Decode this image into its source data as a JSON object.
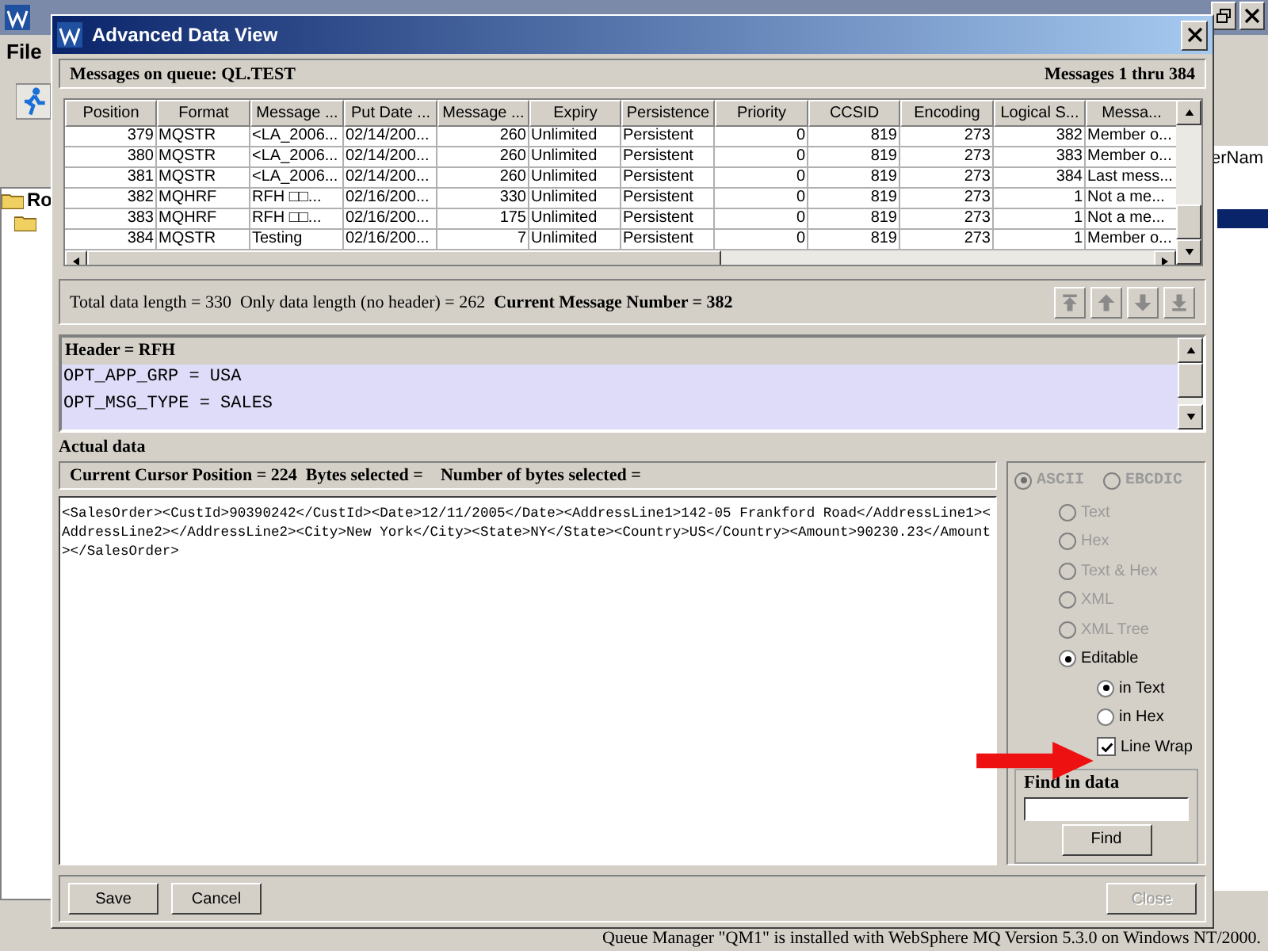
{
  "background": {
    "menu": "File",
    "tree_item": "Ro",
    "column_header": "erNam",
    "status_bar": "Queue Manager \"QM1\" is installed with WebSphere MQ Version 5.3.0 on Windows NT/2000."
  },
  "window": {
    "title": "Advanced Data View"
  },
  "queue_bar": {
    "queue": "Messages on queue: QL.TEST",
    "range": "Messages 1 thru 384"
  },
  "table": {
    "columns": [
      "Position",
      "Format",
      "Message ...",
      "Put Date ...",
      "Message ...",
      "Expiry",
      "Persistence",
      "Priority",
      "CCSID",
      "Encoding",
      "Logical S...",
      "Messa..."
    ],
    "numeric": [
      true,
      false,
      false,
      false,
      true,
      false,
      false,
      true,
      true,
      true,
      true,
      false
    ],
    "rows": [
      [
        "379",
        "MQSTR",
        "<LA_2006...",
        "02/14/200...",
        "260",
        "Unlimited",
        "Persistent",
        "0",
        "819",
        "273",
        "382",
        "Member o..."
      ],
      [
        "380",
        "MQSTR",
        "<LA_2006...",
        "02/14/200...",
        "260",
        "Unlimited",
        "Persistent",
        "0",
        "819",
        "273",
        "383",
        "Member o..."
      ],
      [
        "381",
        "MQSTR",
        "<LA_2006...",
        "02/14/200...",
        "260",
        "Unlimited",
        "Persistent",
        "0",
        "819",
        "273",
        "384",
        "Last mess..."
      ],
      [
        "382",
        "MQHRF",
        "RFH □□...",
        "02/16/200...",
        "330",
        "Unlimited",
        "Persistent",
        "0",
        "819",
        "273",
        "1",
        "Not a me..."
      ],
      [
        "383",
        "MQHRF",
        "RFH □□...",
        "02/16/200...",
        "175",
        "Unlimited",
        "Persistent",
        "0",
        "819",
        "273",
        "1",
        "Not a me..."
      ],
      [
        "384",
        "MQSTR",
        "Testing",
        "02/16/200...",
        "7",
        "Unlimited",
        "Persistent",
        "0",
        "819",
        "273",
        "1",
        "Member o..."
      ]
    ]
  },
  "info_bar": {
    "text": "Total data length = 330  Only data length (no header) = 262  **Current Message Number = 382**",
    "nav_buttons": [
      {
        "kind": "first"
      },
      {
        "kind": "previous"
      },
      {
        "kind": "next"
      },
      {
        "kind": "last"
      }
    ]
  },
  "header_panel": {
    "title": "Header = RFH",
    "lines": [
      "OPT_APP_GRP = USA",
      "OPT_MSG_TYPE = SALES"
    ]
  },
  "actual_data": {
    "label": "Actual data",
    "cursor_bar": "Current Cursor Position = 224  Bytes selected =    Number of bytes selected =",
    "text": "<SalesOrder><CustId>90390242</CustId><Date>12/11/2005</Date><AddressLine1>142-05 Frankford Road</AddressLine1><AddressLine2></AddressLine2><City>New York</City><State>NY</State><Country>US</Country><Amount>90230.23</Amount></SalesOrder>"
  },
  "encoding": [
    {
      "label": "ASCII",
      "selected": true,
      "disabled": true
    },
    {
      "label": "EBCDIC",
      "selected": false,
      "disabled": true
    }
  ],
  "view_modes": [
    {
      "label": "Text",
      "selected": false,
      "disabled": true
    },
    {
      "label": "Hex",
      "selected": false,
      "disabled": true
    },
    {
      "label": "Text & Hex",
      "selected": false,
      "disabled": true
    },
    {
      "label": "XML",
      "selected": false,
      "disabled": true
    },
    {
      "label": "XML Tree",
      "selected": false,
      "disabled": true
    },
    {
      "label": "Editable",
      "selected": true,
      "disabled": false,
      "children": [
        {
          "kind": "radio",
          "label": "in Text",
          "selected": true
        },
        {
          "kind": "radio",
          "label": "in Hex",
          "selected": false
        },
        {
          "kind": "checkbox",
          "label": "Line Wrap",
          "checked": true
        }
      ]
    }
  ],
  "find": {
    "label": "Find in data",
    "button": "Find"
  },
  "buttons": [
    {
      "label": "Save",
      "disabled": false
    },
    {
      "label": "Cancel",
      "disabled": false
    },
    {
      "label": "Close",
      "disabled": true
    }
  ]
}
